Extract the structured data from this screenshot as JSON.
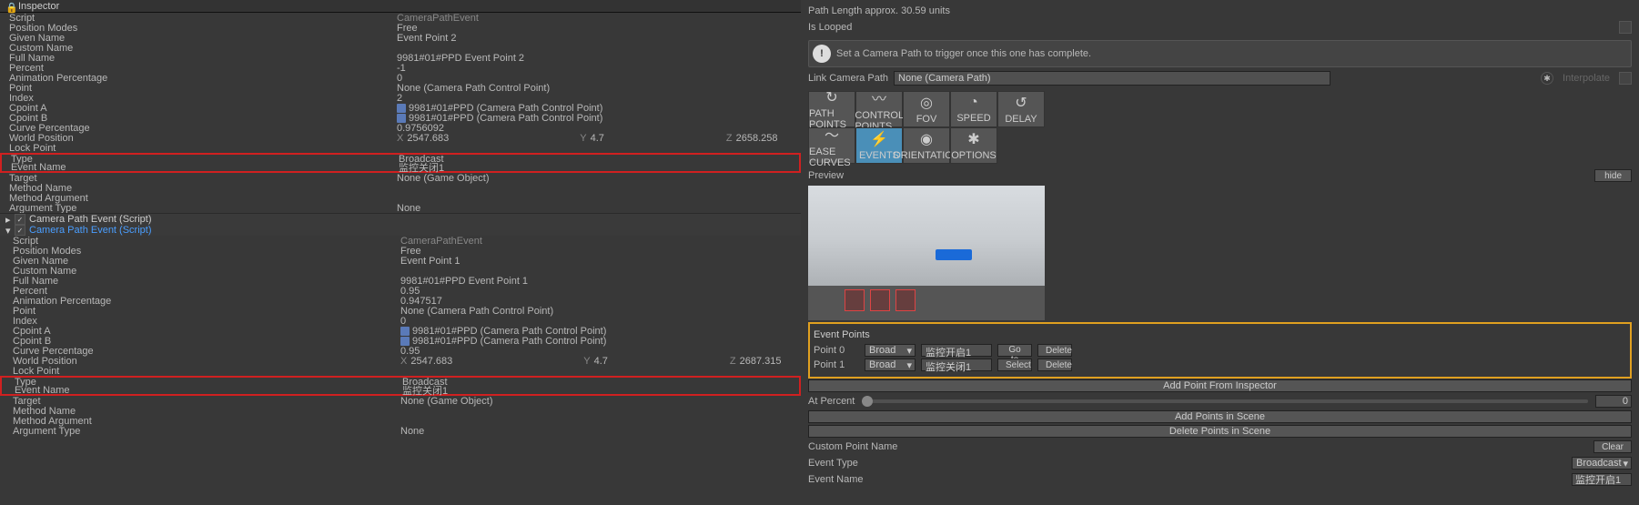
{
  "inspector_tab": "Inspector",
  "block1": {
    "Script": "CameraPathEvent",
    "Position Modes": "Free",
    "Given Name": "Event Point 2",
    "Custom Name": "",
    "Full Name": "9981#01#PPD Event Point 2",
    "Percent": "-1",
    "Animation Percentage": "0",
    "Point": "None (Camera Path Control Point)",
    "Index": "2",
    "Cpoint A": "9981#01#PPD (Camera Path Control Point)",
    "Cpoint B": "9981#01#PPD (Camera Path Control Point)",
    "Curve Percentage": "0.9756092",
    "WorldPosition": {
      "x": "2547.683",
      "y": "4.7",
      "z": "2658.258"
    },
    "Lock Point": "",
    "Type": "Broadcast",
    "Event Name": "监控关闭1",
    "Target": "None (Game Object)",
    "Method Name": "",
    "Method Argument": "",
    "Argument Type": "None"
  },
  "component1": {
    "name": "Camera Path Event (Script)"
  },
  "component2": {
    "name": "Camera Path Event (Script)"
  },
  "block2": {
    "Script": "CameraPathEvent",
    "Position Modes": "Free",
    "Given Name": "Event Point 1",
    "Custom Name": "",
    "Full Name": "9981#01#PPD Event Point 1",
    "Percent": "0.95",
    "Animation Percentage": "0.947517",
    "Point": "None (Camera Path Control Point)",
    "Index": "0",
    "Cpoint A": "9981#01#PPD (Camera Path Control Point)",
    "Cpoint B": "9981#01#PPD (Camera Path Control Point)",
    "Curve Percentage": "0.95",
    "WorldPosition": {
      "x": "2547.683",
      "y": "4.7",
      "z": "2687.315"
    },
    "Lock Point": "",
    "Type": "Broadcast",
    "Event Name": "监控关闭1",
    "Target": "None (Game Object)",
    "Method Name": "",
    "Method Argument": "",
    "Argument Type": "None"
  },
  "right": {
    "path_length": "Path Length approx. 30.59 units",
    "is_looped": "Is Looped",
    "banner": "Set a Camera Path to trigger once this one has complete.",
    "link_label": "Link Camera Path",
    "link_value": "None (Camera Path)",
    "interpolate": "Interpolate",
    "modes": [
      "PATH POINTS",
      "CONTROL POINTS",
      "FOV",
      "SPEED",
      "DELAY",
      "EASE CURVES",
      "EVENTS",
      "ORIENTATION",
      "OPTIONS"
    ],
    "preview": "Preview",
    "hide": "hide",
    "event_points_header": "Event Points",
    "points": [
      {
        "label": "Point 0",
        "mode": "Broad",
        "name": "监控开启1",
        "b1": "Go to",
        "b2": "Delete"
      },
      {
        "label": "Point 1",
        "mode": "Broad",
        "name": "监控关闭1",
        "b1": "Select",
        "b2": "Delete"
      }
    ],
    "add_from_inspector": "Add Point From Inspector",
    "at_percent": "At Percent",
    "at_percent_val": "0",
    "add_in_scene": "Add Points in Scene",
    "del_in_scene": "Delete Points in Scene",
    "clear": "Clear",
    "cpn_label": "Custom Point Name",
    "event_type_label": "Event Type",
    "event_type_val": "Broadcast",
    "event_name_label": "Event Name",
    "event_name_val": "监控开启1"
  }
}
